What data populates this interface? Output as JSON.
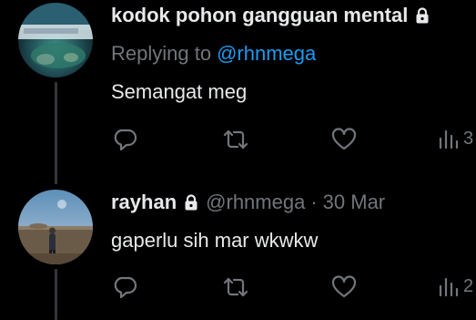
{
  "tweets": [
    {
      "display_name": "kodok pohon gangguan mental",
      "protected_icon": "lock-icon",
      "reply_prefix": "Replying to",
      "reply_to": "@rhnmega",
      "text": "Semangat meg",
      "views": "3"
    },
    {
      "display_name": "rayhan",
      "protected_icon": "lock-icon",
      "handle": "@rhnmega",
      "separator": "·",
      "date": "30 Mar",
      "text": "gaperlu sih mar wkwkw",
      "views": "2"
    }
  ],
  "actions": {
    "reply_icon": "reply-icon",
    "retweet_icon": "retweet-icon",
    "like_icon": "heart-icon",
    "views_icon": "views-icon"
  },
  "colors": {
    "background": "#000000",
    "primary_text": "#e7e9ea",
    "secondary_text": "#71767b",
    "accent": "#1d9bf0",
    "thread_line": "#333639"
  }
}
